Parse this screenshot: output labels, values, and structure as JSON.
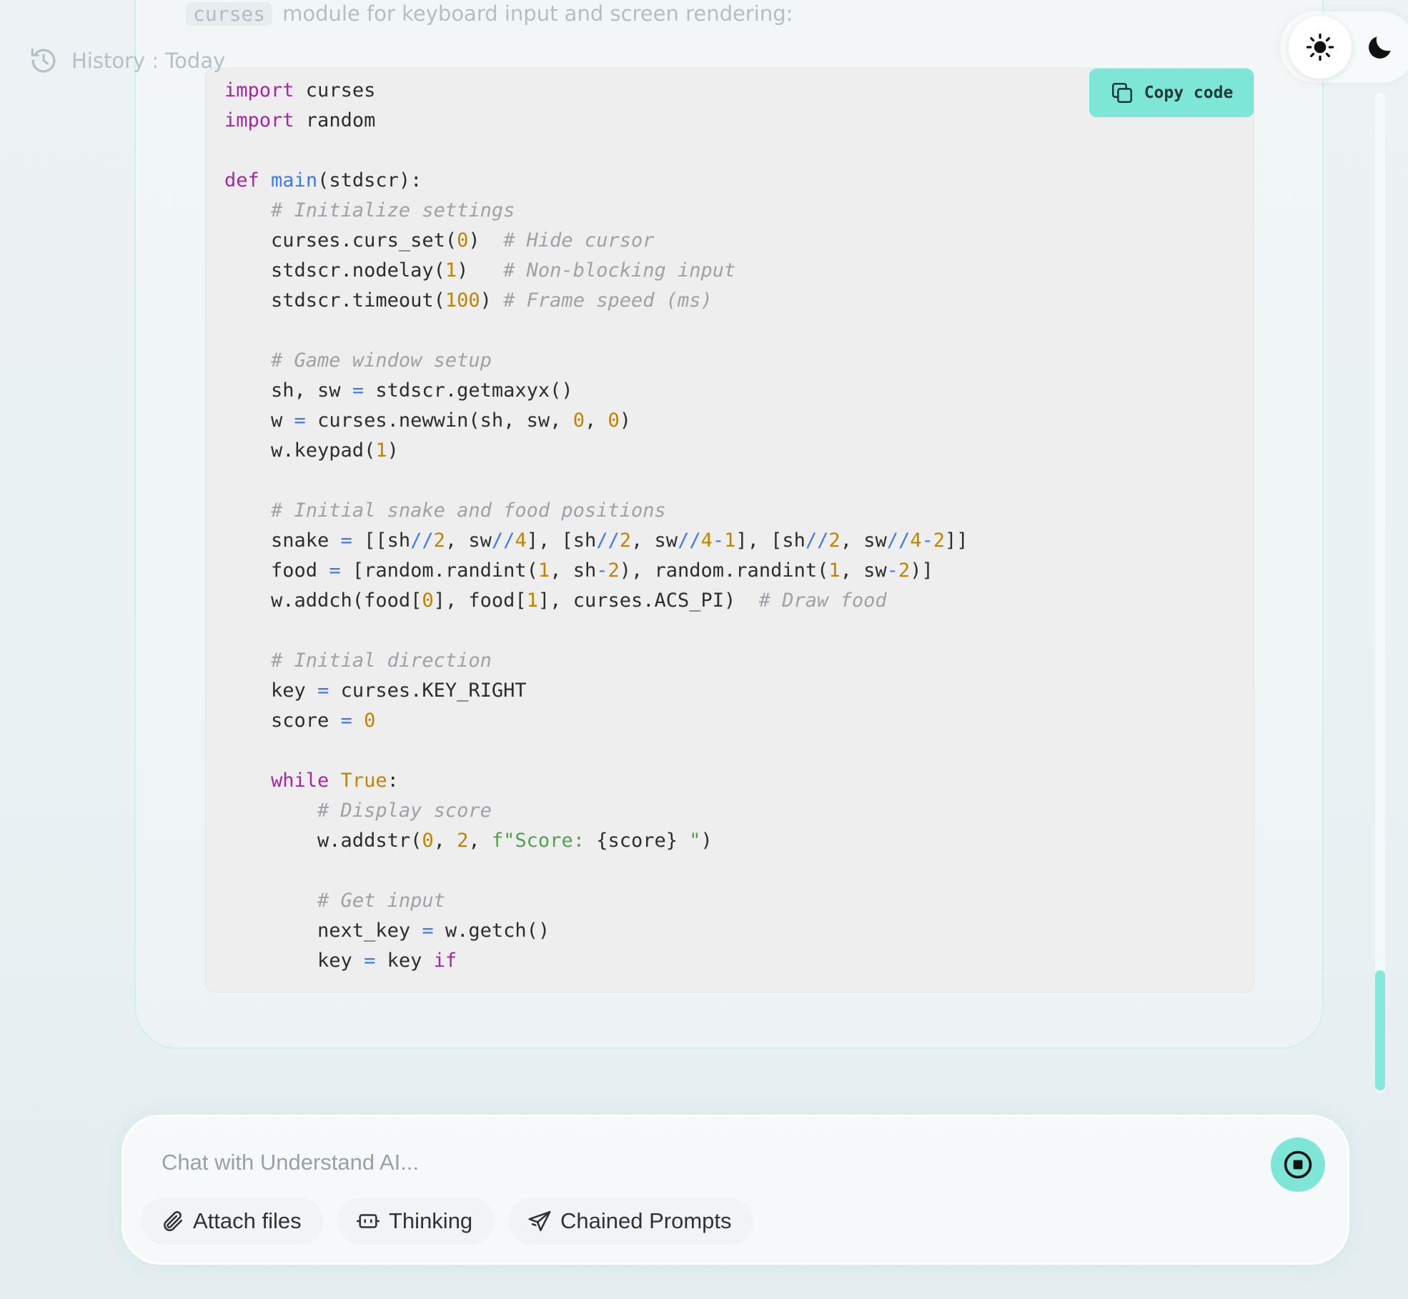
{
  "intro": {
    "code": "curses",
    "text": "module for keyboard input and screen rendering:"
  },
  "history": {
    "label": "History : Today"
  },
  "code": {
    "copy_label": "Copy code",
    "lines": [
      [
        {
          "t": "kw",
          "s": "import"
        },
        {
          "t": "p",
          "s": " curses"
        }
      ],
      [
        {
          "t": "kw",
          "s": "import"
        },
        {
          "t": "p",
          "s": " random"
        }
      ],
      [],
      [
        {
          "t": "kw",
          "s": "def"
        },
        {
          "t": "p",
          "s": " "
        },
        {
          "t": "fn",
          "s": "main"
        },
        {
          "t": "p",
          "s": "(stdscr):"
        }
      ],
      [
        {
          "t": "p",
          "s": "    "
        },
        {
          "t": "cm",
          "s": "# Initialize settings"
        }
      ],
      [
        {
          "t": "p",
          "s": "    curses.curs_set("
        },
        {
          "t": "num",
          "s": "0"
        },
        {
          "t": "p",
          "s": ")  "
        },
        {
          "t": "cm",
          "s": "# Hide cursor"
        }
      ],
      [
        {
          "t": "p",
          "s": "    stdscr.nodelay("
        },
        {
          "t": "num",
          "s": "1"
        },
        {
          "t": "p",
          "s": ")   "
        },
        {
          "t": "cm",
          "s": "# Non-blocking input"
        }
      ],
      [
        {
          "t": "p",
          "s": "    stdscr.timeout("
        },
        {
          "t": "num",
          "s": "100"
        },
        {
          "t": "p",
          "s": ") "
        },
        {
          "t": "cm",
          "s": "# Frame speed (ms)"
        }
      ],
      [],
      [
        {
          "t": "p",
          "s": "    "
        },
        {
          "t": "cm",
          "s": "# Game window setup"
        }
      ],
      [
        {
          "t": "p",
          "s": "    sh, sw "
        },
        {
          "t": "op",
          "s": "="
        },
        {
          "t": "p",
          "s": " stdscr.getmaxyx()"
        }
      ],
      [
        {
          "t": "p",
          "s": "    w "
        },
        {
          "t": "op",
          "s": "="
        },
        {
          "t": "p",
          "s": " curses.newwin(sh, sw, "
        },
        {
          "t": "num",
          "s": "0"
        },
        {
          "t": "p",
          "s": ", "
        },
        {
          "t": "num",
          "s": "0"
        },
        {
          "t": "p",
          "s": ")"
        }
      ],
      [
        {
          "t": "p",
          "s": "    w.keypad("
        },
        {
          "t": "num",
          "s": "1"
        },
        {
          "t": "p",
          "s": ")"
        }
      ],
      [],
      [
        {
          "t": "p",
          "s": "    "
        },
        {
          "t": "cm",
          "s": "# Initial snake and food positions"
        }
      ],
      [
        {
          "t": "p",
          "s": "    snake "
        },
        {
          "t": "op",
          "s": "="
        },
        {
          "t": "p",
          "s": " [[sh"
        },
        {
          "t": "op",
          "s": "//"
        },
        {
          "t": "num",
          "s": "2"
        },
        {
          "t": "p",
          "s": ", sw"
        },
        {
          "t": "op",
          "s": "//"
        },
        {
          "t": "num",
          "s": "4"
        },
        {
          "t": "p",
          "s": "], [sh"
        },
        {
          "t": "op",
          "s": "//"
        },
        {
          "t": "num",
          "s": "2"
        },
        {
          "t": "p",
          "s": ", sw"
        },
        {
          "t": "op",
          "s": "//"
        },
        {
          "t": "num",
          "s": "4"
        },
        {
          "t": "op",
          "s": "-"
        },
        {
          "t": "num",
          "s": "1"
        },
        {
          "t": "p",
          "s": "], [sh"
        },
        {
          "t": "op",
          "s": "//"
        },
        {
          "t": "num",
          "s": "2"
        },
        {
          "t": "p",
          "s": ", sw"
        },
        {
          "t": "op",
          "s": "//"
        },
        {
          "t": "num",
          "s": "4"
        },
        {
          "t": "op",
          "s": "-"
        },
        {
          "t": "num",
          "s": "2"
        },
        {
          "t": "p",
          "s": "]]"
        }
      ],
      [
        {
          "t": "p",
          "s": "    food "
        },
        {
          "t": "op",
          "s": "="
        },
        {
          "t": "p",
          "s": " [random.randint("
        },
        {
          "t": "num",
          "s": "1"
        },
        {
          "t": "p",
          "s": ", sh"
        },
        {
          "t": "op",
          "s": "-"
        },
        {
          "t": "num",
          "s": "2"
        },
        {
          "t": "p",
          "s": "), random.randint("
        },
        {
          "t": "num",
          "s": "1"
        },
        {
          "t": "p",
          "s": ", sw"
        },
        {
          "t": "op",
          "s": "-"
        },
        {
          "t": "num",
          "s": "2"
        },
        {
          "t": "p",
          "s": ")]"
        }
      ],
      [
        {
          "t": "p",
          "s": "    w.addch(food["
        },
        {
          "t": "num",
          "s": "0"
        },
        {
          "t": "p",
          "s": "], food["
        },
        {
          "t": "num",
          "s": "1"
        },
        {
          "t": "p",
          "s": "], curses.ACS_PI)  "
        },
        {
          "t": "cm",
          "s": "# Draw food"
        }
      ],
      [],
      [
        {
          "t": "p",
          "s": "    "
        },
        {
          "t": "cm",
          "s": "# Initial direction"
        }
      ],
      [
        {
          "t": "p",
          "s": "    key "
        },
        {
          "t": "op",
          "s": "="
        },
        {
          "t": "p",
          "s": " curses.KEY_RIGHT"
        }
      ],
      [
        {
          "t": "p",
          "s": "    score "
        },
        {
          "t": "op",
          "s": "="
        },
        {
          "t": "p",
          "s": " "
        },
        {
          "t": "num",
          "s": "0"
        }
      ],
      [],
      [
        {
          "t": "p",
          "s": "    "
        },
        {
          "t": "kw",
          "s": "while"
        },
        {
          "t": "p",
          "s": " "
        },
        {
          "t": "bool",
          "s": "True"
        },
        {
          "t": "p",
          "s": ":"
        }
      ],
      [
        {
          "t": "p",
          "s": "        "
        },
        {
          "t": "cm",
          "s": "# Display score"
        }
      ],
      [
        {
          "t": "p",
          "s": "        w.addstr("
        },
        {
          "t": "num",
          "s": "0"
        },
        {
          "t": "p",
          "s": ", "
        },
        {
          "t": "num",
          "s": "2"
        },
        {
          "t": "p",
          "s": ", "
        },
        {
          "t": "str",
          "s": "f\"Score: "
        },
        {
          "t": "p",
          "s": "{score}"
        },
        {
          "t": "str",
          "s": " \""
        },
        {
          "t": "p",
          "s": ")"
        }
      ],
      [],
      [
        {
          "t": "p",
          "s": "        "
        },
        {
          "t": "cm",
          "s": "# Get input"
        }
      ],
      [
        {
          "t": "p",
          "s": "        next_key "
        },
        {
          "t": "op",
          "s": "="
        },
        {
          "t": "p",
          "s": " w.getch()"
        }
      ],
      [
        {
          "t": "p",
          "s": "        key "
        },
        {
          "t": "op",
          "s": "="
        },
        {
          "t": "p",
          "s": " key "
        },
        {
          "t": "kw",
          "s": "if"
        }
      ]
    ]
  },
  "chat": {
    "placeholder": "Chat with Understand AI...",
    "attach_label": "Attach files",
    "thinking_label": "Thinking",
    "chained_label": "Chained Prompts"
  },
  "icons": {
    "history": "history-icon",
    "sun": "sun-icon",
    "moon": "moon-icon",
    "copy": "copy-icon",
    "stop": "stop-icon",
    "attach": "paperclip-icon",
    "thinking": "chip-icon",
    "chained": "paper-plane-icon"
  },
  "colors": {
    "accent": "#7de6d6",
    "card_border": "#d0f0ea"
  }
}
